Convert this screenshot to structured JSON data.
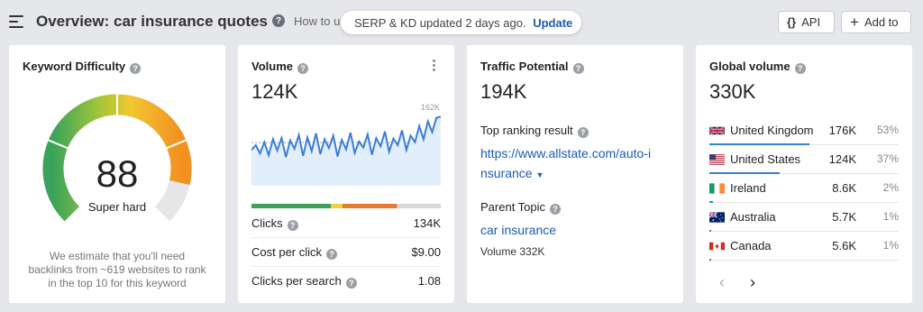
{
  "header": {
    "title": "Overview: car insurance quotes",
    "howto_text": "How to u",
    "toast_text": "SERP & KD updated 2 days ago.",
    "toast_action": "Update",
    "api_label": "API",
    "add_to_label": "Add to"
  },
  "keyword_difficulty": {
    "title": "Keyword Difficulty",
    "score": "88",
    "score_value": 88,
    "label": "Super hard",
    "note": "We estimate that you'll need backlinks from ~619 websites to rank in the top 10 for this keyword"
  },
  "volume": {
    "title": "Volume",
    "value": "124K",
    "chart_max_label": "162K",
    "trend": [
      0.42,
      0.5,
      0.36,
      0.55,
      0.33,
      0.6,
      0.41,
      0.62,
      0.3,
      0.58,
      0.44,
      0.67,
      0.32,
      0.63,
      0.4,
      0.7,
      0.35,
      0.6,
      0.45,
      0.66,
      0.31,
      0.59,
      0.43,
      0.71,
      0.37,
      0.56,
      0.46,
      0.68,
      0.34,
      0.62,
      0.48,
      0.73,
      0.39,
      0.61,
      0.5,
      0.75,
      0.42,
      0.66,
      0.55,
      0.82,
      0.6,
      0.9,
      0.72,
      0.96,
      0.98
    ],
    "bar_segments": [
      {
        "color": "#3aa35b",
        "fraction": 0.42
      },
      {
        "color": "#f2d13a",
        "fraction": 0.06
      },
      {
        "color": "#ec7a2a",
        "fraction": 0.29
      },
      {
        "color": "#d8d8d8",
        "fraction": 0.23
      }
    ],
    "metrics": [
      {
        "label": "Clicks",
        "value": "134K"
      },
      {
        "label": "Cost per click",
        "value": "$9.00"
      },
      {
        "label": "Clicks per search",
        "value": "1.08"
      }
    ]
  },
  "traffic_potential": {
    "title": "Traffic Potential",
    "value": "194K",
    "top_result_label": "Top ranking result",
    "top_result_line1": "https://www.allstate.com/auto-i",
    "top_result_line2": "nsurance",
    "parent_topic_label": "Parent Topic",
    "parent_topic": "car insurance",
    "parent_volume": "Volume 332K"
  },
  "global_volume": {
    "title": "Global volume",
    "value": "330K",
    "countries": [
      {
        "name": "United Kingdom",
        "volume": "176K",
        "pct": "53%",
        "share": 0.53,
        "flag": "uk-flag-icon"
      },
      {
        "name": "United States",
        "volume": "124K",
        "pct": "37%",
        "share": 0.37,
        "flag": "us-flag-icon"
      },
      {
        "name": "Ireland",
        "volume": "8.6K",
        "pct": "2%",
        "share": 0.02,
        "flag": "ireland-flag-icon"
      },
      {
        "name": "Australia",
        "volume": "5.7K",
        "pct": "1%",
        "share": 0.01,
        "flag": "australia-flag-icon"
      },
      {
        "name": "Canada",
        "volume": "5.6K",
        "pct": "1%",
        "share": 0.01,
        "flag": "canada-flag-icon"
      }
    ],
    "prev_icon": "chevron-left-icon",
    "next_icon": "chevron-right-icon"
  },
  "colors": {
    "link": "#1a5cb8",
    "bar": "#3b7ed6",
    "spark_line": "#3b7ed6"
  }
}
